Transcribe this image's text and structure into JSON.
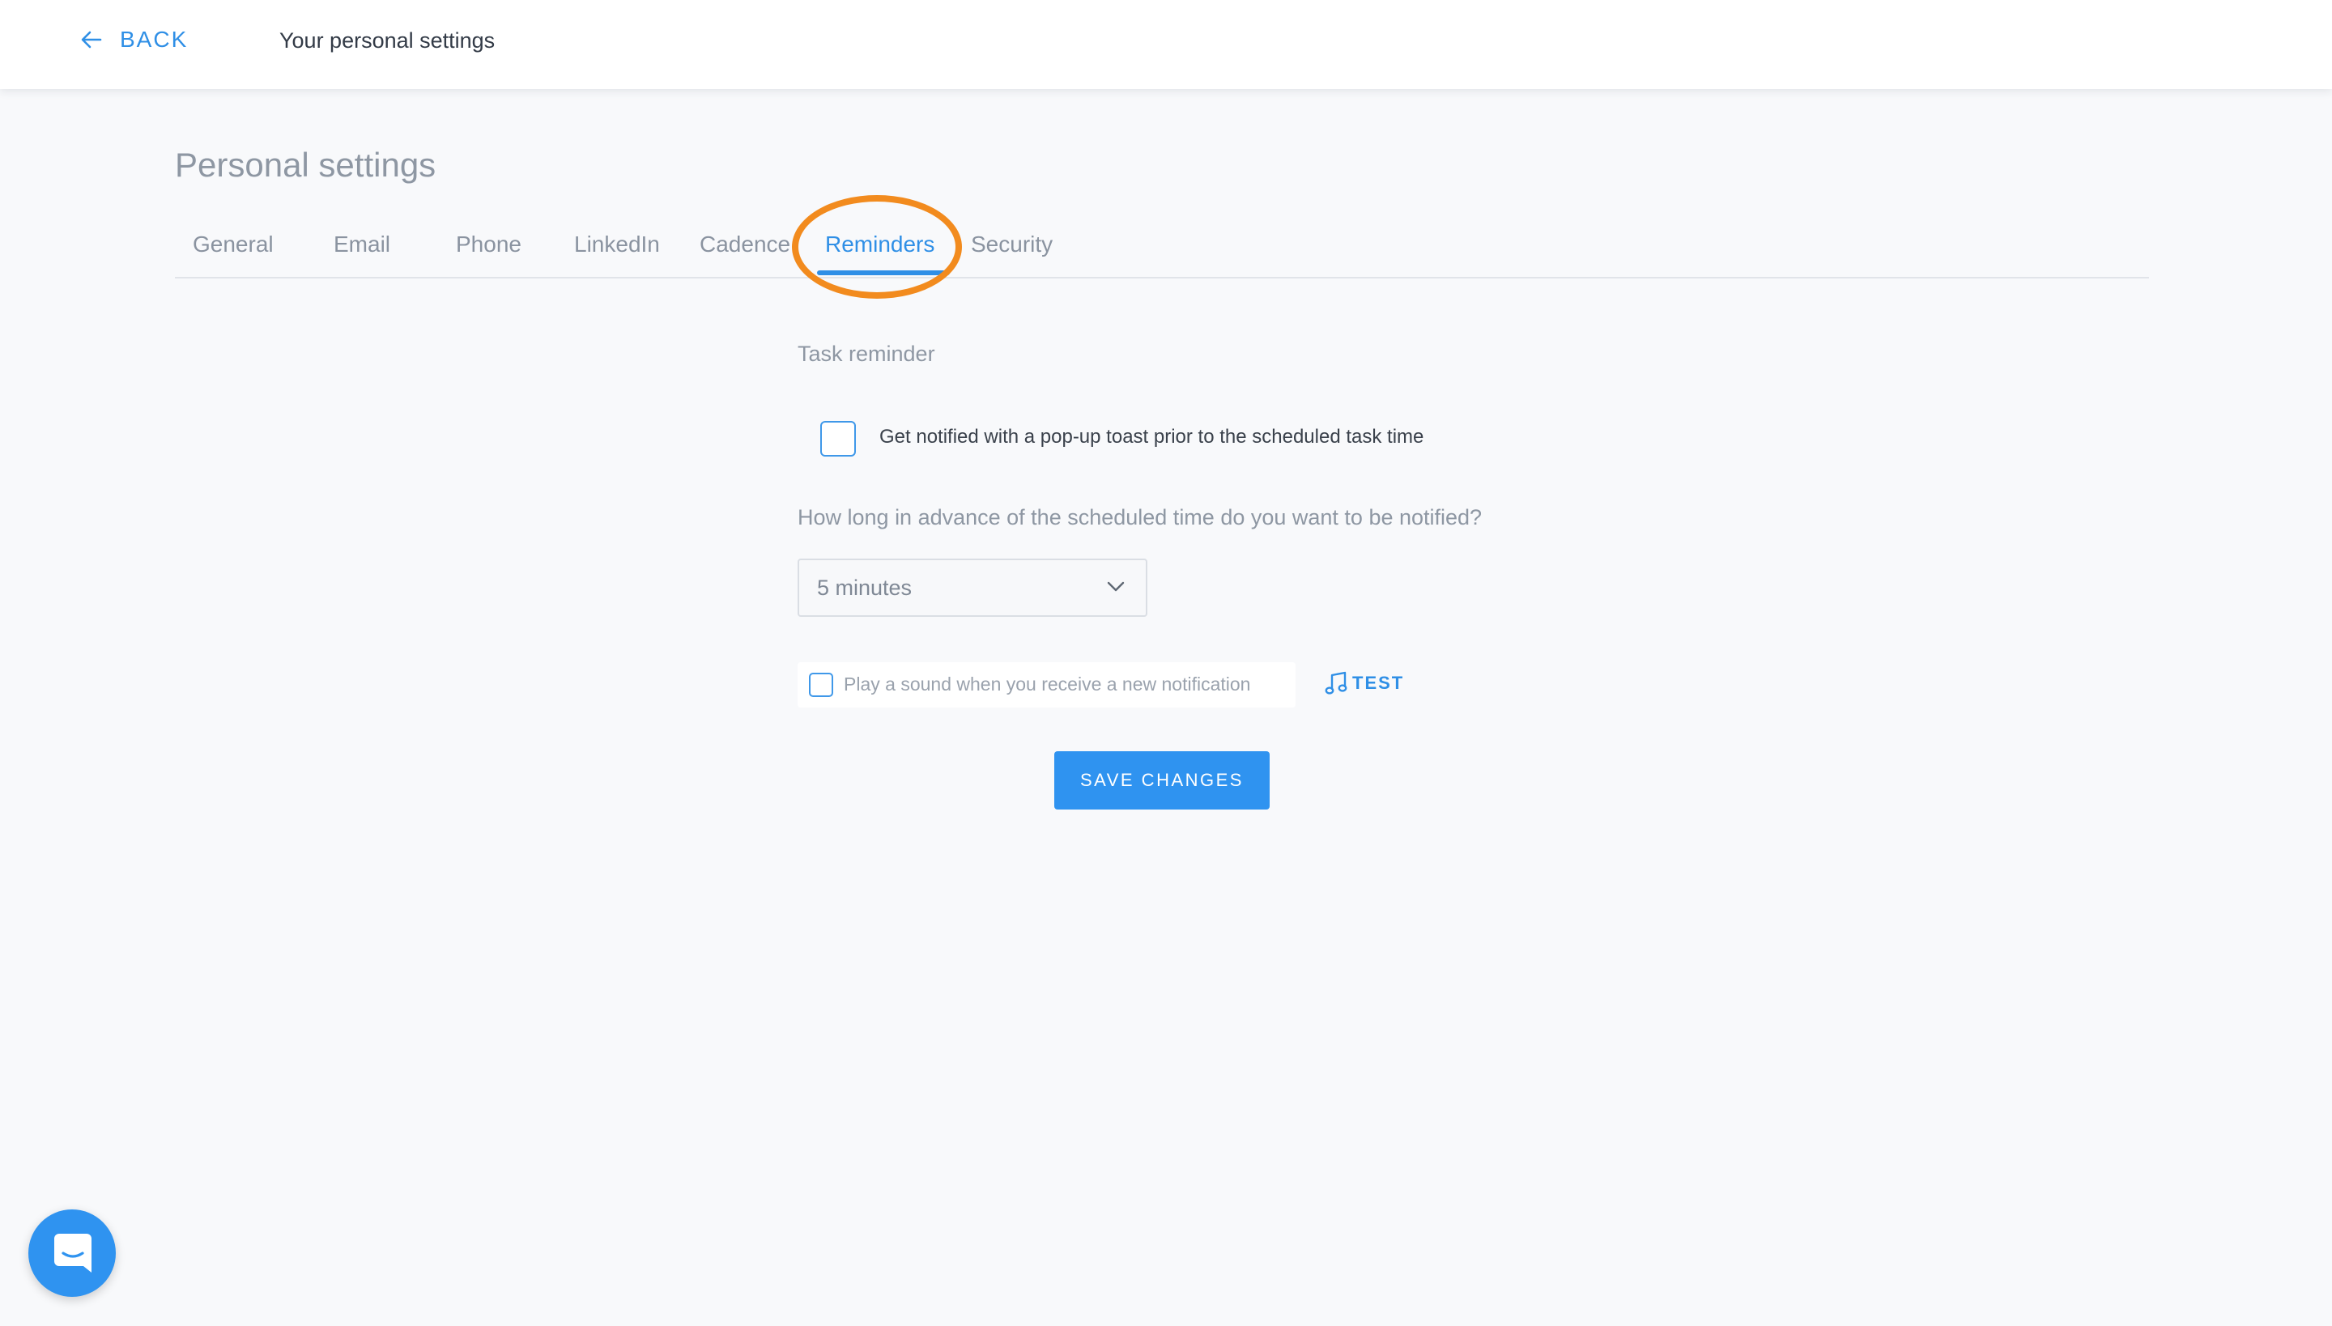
{
  "topbar": {
    "back_label": "BACK",
    "title": "Your personal settings"
  },
  "page": {
    "title": "Personal settings"
  },
  "tabs": [
    {
      "label": "General",
      "active": false
    },
    {
      "label": "Email",
      "active": false
    },
    {
      "label": "Phone",
      "active": false
    },
    {
      "label": "LinkedIn",
      "active": false
    },
    {
      "label": "Cadence",
      "active": false
    },
    {
      "label": "Reminders",
      "active": true
    },
    {
      "label": "Security",
      "active": false
    }
  ],
  "reminders": {
    "section_label": "Task reminder",
    "toast_checkbox_label": "Get notified with a pop-up toast prior to the scheduled task time",
    "toast_checked": false,
    "advance_question": "How long in advance of the scheduled time do you want to be notified?",
    "advance_select_value": "5 minutes",
    "sound_checkbox_label": "Play a sound when you receive a new notification",
    "sound_checked": false,
    "test_label": "TEST",
    "save_label": "SAVE CHANGES"
  },
  "icons": {
    "back": "arrow-left-icon",
    "chevron": "chevron-down-icon",
    "test": "music-note-icon",
    "chat": "chat-icon"
  },
  "colors": {
    "accent": "#2f8fe6",
    "highlight_ring": "#f28b1e",
    "background": "#f8f9fb"
  }
}
